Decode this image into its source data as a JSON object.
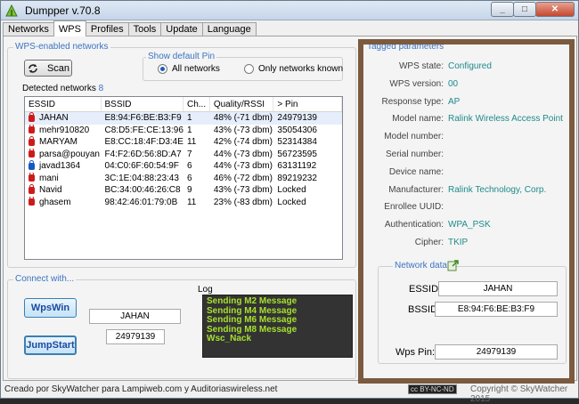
{
  "window": {
    "title": "Dumpper v.70.8"
  },
  "tabs": [
    "Networks",
    "WPS",
    "Profiles",
    "Tools",
    "Update",
    "Language"
  ],
  "wps_panel": {
    "title": "WPS-enabled networks",
    "scan_label": "Scan",
    "show_pin_title": "Show default Pin",
    "radio_all": "All networks",
    "radio_known": "Only networks known",
    "detected_label": "Detected networks",
    "detected_count": "8",
    "columns": [
      "ESSID",
      "BSSID",
      "Ch...",
      "Quality/RSSI",
      "> Pin"
    ],
    "rows": [
      {
        "essid": "JAHAN",
        "bssid": "E8:94:F6:BE:B3:F9",
        "ch": "1",
        "quality": "48% (-71 dbm)",
        "pin": "24979139",
        "lock": "red"
      },
      {
        "essid": "mehr910820",
        "bssid": "C8:D5:FE:CE:13:96",
        "ch": "1",
        "quality": "43% (-73 dbm)",
        "pin": "35054306",
        "lock": "red"
      },
      {
        "essid": "MARYAM",
        "bssid": "E8:CC:18:4F:D3:4E",
        "ch": "11",
        "quality": "42% (-74 dbm)",
        "pin": "52314384",
        "lock": "red"
      },
      {
        "essid": "parsa@pouyan",
        "bssid": "F4:F2:6D:56:8D:A7",
        "ch": "7",
        "quality": "44% (-73 dbm)",
        "pin": "56723595",
        "lock": "red"
      },
      {
        "essid": "javad1364",
        "bssid": "04:C0:6F:60:54:9F",
        "ch": "6",
        "quality": "44% (-73 dbm)",
        "pin": "63131192",
        "lock": "blue"
      },
      {
        "essid": "mani",
        "bssid": "3C:1E:04:88:23:43",
        "ch": "6",
        "quality": "46% (-72 dbm)",
        "pin": "89219232",
        "lock": "red"
      },
      {
        "essid": "Navid",
        "bssid": "BC:34:00:46:26:C8",
        "ch": "9",
        "quality": "43% (-73 dbm)",
        "pin": "Locked",
        "lock": "red"
      },
      {
        "essid": "ghasem",
        "bssid": "98:42:46:01:79:0B",
        "ch": "11",
        "quality": "23% (-83 dbm)",
        "pin": "Locked",
        "lock": "red"
      }
    ]
  },
  "connect_panel": {
    "title": "Connect with...",
    "wpswin_label": "WpsWin",
    "jumpstart_label": "JumpStart",
    "essid_value": "JAHAN",
    "pin_value": "24979139",
    "log_title": "Log",
    "log_lines": [
      "Sending M2 Message",
      "Sending M4 Message",
      "Sending M6 Message",
      "Sending M8 Message",
      "Wsc_Nack"
    ]
  },
  "tagged": {
    "title": "Tagged parameters",
    "fields": [
      {
        "key": "WPS state:",
        "value": "Configured"
      },
      {
        "key": "WPS version:",
        "value": "00"
      },
      {
        "key": "Response type:",
        "value": "AP"
      },
      {
        "key": "Model name:",
        "value": "Ralink Wireless Access Point"
      },
      {
        "key": "Model number:",
        "value": ""
      },
      {
        "key": "Serial number:",
        "value": ""
      },
      {
        "key": "Device name:",
        "value": ""
      },
      {
        "key": "Manufacturer:",
        "value": "Ralink Technology, Corp."
      },
      {
        "key": "Enrollee UUID:",
        "value": ""
      },
      {
        "key": "Authentication:",
        "value": "WPA_PSK"
      },
      {
        "key": "Cipher:",
        "value": "TKIP"
      }
    ]
  },
  "network_data": {
    "title": "Network data",
    "essid_label": "ESSID:",
    "essid_value": "JAHAN",
    "bssid_label": "BSSID:",
    "bssid_value": "E8:94:F6:BE:B3:F9",
    "pin_label": "Wps Pin:",
    "pin_value": "24979139"
  },
  "status": {
    "credit": "Creado por SkyWatcher para Lampiweb.com y Auditoriaswireless.net",
    "license": "cc BY-NC-ND",
    "copyright": "Copyright © SkyWatcher 2015"
  },
  "colors": {
    "accent": "#3b73c2",
    "highlight": "#7b5a3f",
    "value": "#1f8a8a",
    "log_text": "#a6e22e"
  }
}
